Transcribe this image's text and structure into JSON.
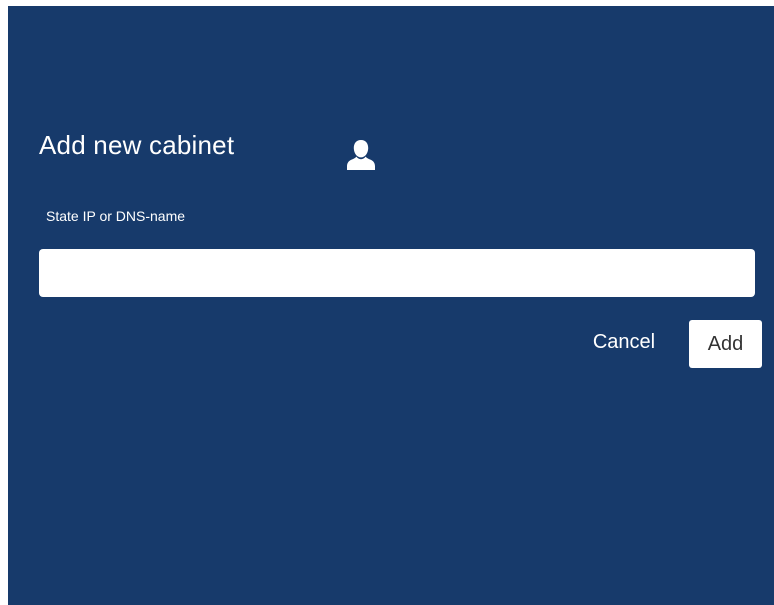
{
  "dialog": {
    "title": "Add new cabinet",
    "icon": "user-icon",
    "field_label": "State IP or DNS-name",
    "field_value": "",
    "field_placeholder": "",
    "cancel_label": "Cancel",
    "add_label": "Add"
  },
  "colors": {
    "background": "#173a6b",
    "text": "#ffffff",
    "button_background": "#ffffff",
    "button_text": "#333333"
  }
}
